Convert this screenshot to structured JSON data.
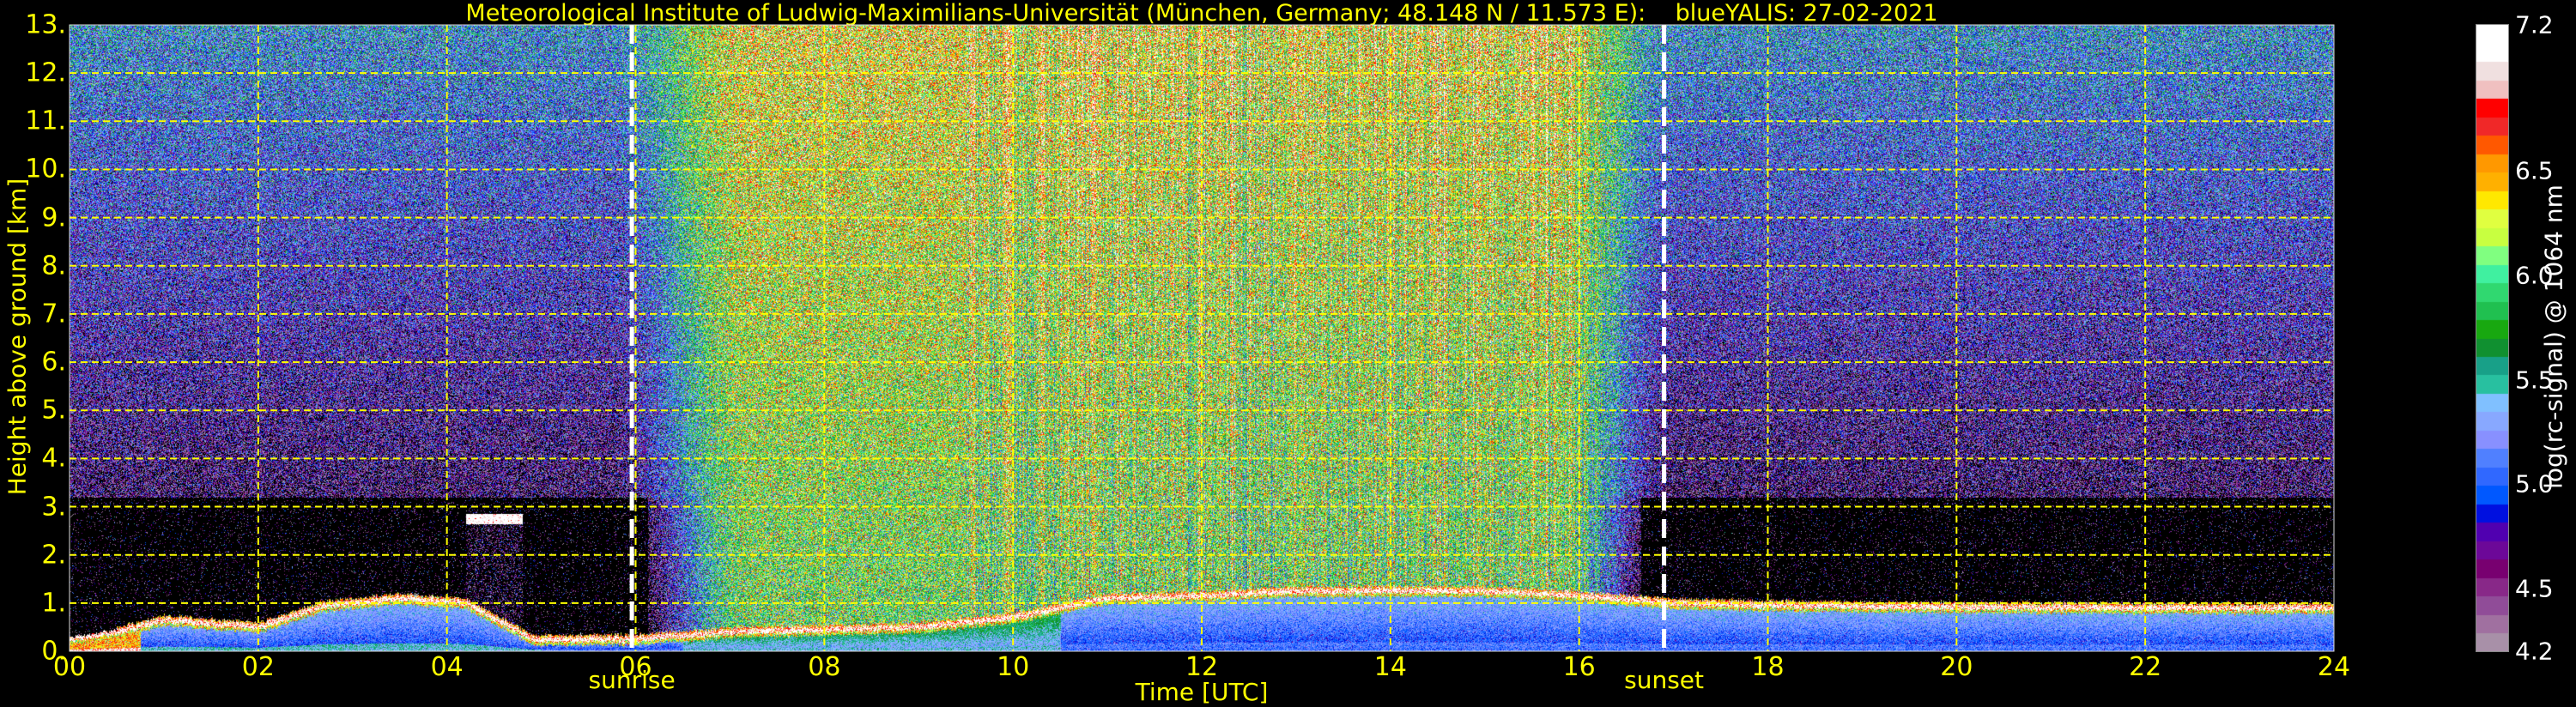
{
  "chart_data": {
    "type": "heatmap",
    "title": "Meteorological Institute of Ludwig-Maximilians-Universität (München, Germany; 48.148 N / 11.573 E):    blueYALIS: 27-02-2021",
    "xlabel": "Time [UTC]",
    "ylabel": "Height above ground [km]",
    "xlim": [
      0,
      24
    ],
    "ylim": [
      0,
      13
    ],
    "x_ticks": [
      "00",
      "02",
      "04",
      "06",
      "08",
      "10",
      "12",
      "14",
      "16",
      "18",
      "20",
      "22",
      "24"
    ],
    "y_ticks": [
      "0.",
      "1.",
      "2.",
      "3.",
      "4.",
      "5.",
      "6.",
      "7.",
      "8.",
      "9.",
      "10.",
      "11.",
      "12.",
      "13."
    ],
    "grid": true,
    "grid_color": "#ffff00",
    "colorbar": {
      "label": "log(rc-signal) @ 1064 nm",
      "range": [
        4.2,
        7.2
      ],
      "ticks": [
        "7.2",
        "6.5",
        "6.0",
        "5.5",
        "5.0",
        "4.5",
        "4.2"
      ],
      "tick_values": [
        7.2,
        6.5,
        6.0,
        5.5,
        5.0,
        4.5,
        4.2
      ],
      "colors": [
        "#a890a8",
        "#a070a0",
        "#904c98",
        "#882888",
        "#780070",
        "#6c0898",
        "#5000b0",
        "#0010e0",
        "#0058ff",
        "#3068ff",
        "#5080ff",
        "#8890ff",
        "#88a8ff",
        "#80c0ff",
        "#28c0a0",
        "#18a088",
        "#109030",
        "#18a810",
        "#20c050",
        "#30d870",
        "#40f0a0",
        "#80ff80",
        "#c8ff40",
        "#e0ff40",
        "#ffe800",
        "#ffb000",
        "#ff9800",
        "#ff5800",
        "#f02828",
        "#ff0000",
        "#f0c0c0",
        "#f0e0e0",
        "#ffffff",
        "#ffffff"
      ]
    },
    "annotations": [
      {
        "label": "sunrise",
        "time_utc": 5.96
      },
      {
        "label": "sunset",
        "time_utc": 16.9
      }
    ],
    "aerosol_layer_top_km": {
      "time_utc": [
        0,
        0.5,
        1,
        2,
        2.7,
        3.5,
        4.2,
        4.9,
        6,
        7,
        8,
        9,
        10,
        11,
        12,
        13,
        14,
        15,
        16,
        17,
        18,
        20,
        22,
        24
      ],
      "height_km": [
        0.3,
        0.45,
        0.7,
        0.55,
        1.0,
        1.15,
        1.05,
        0.3,
        0.3,
        0.45,
        0.5,
        0.55,
        0.75,
        1.15,
        1.2,
        1.3,
        1.3,
        1.3,
        1.2,
        1.05,
        1.0,
        0.97,
        0.95,
        0.95
      ]
    },
    "cloud_layer": {
      "time_utc": [
        4.2,
        4.8
      ],
      "height_km": [
        2.65,
        2.85
      ]
    }
  }
}
